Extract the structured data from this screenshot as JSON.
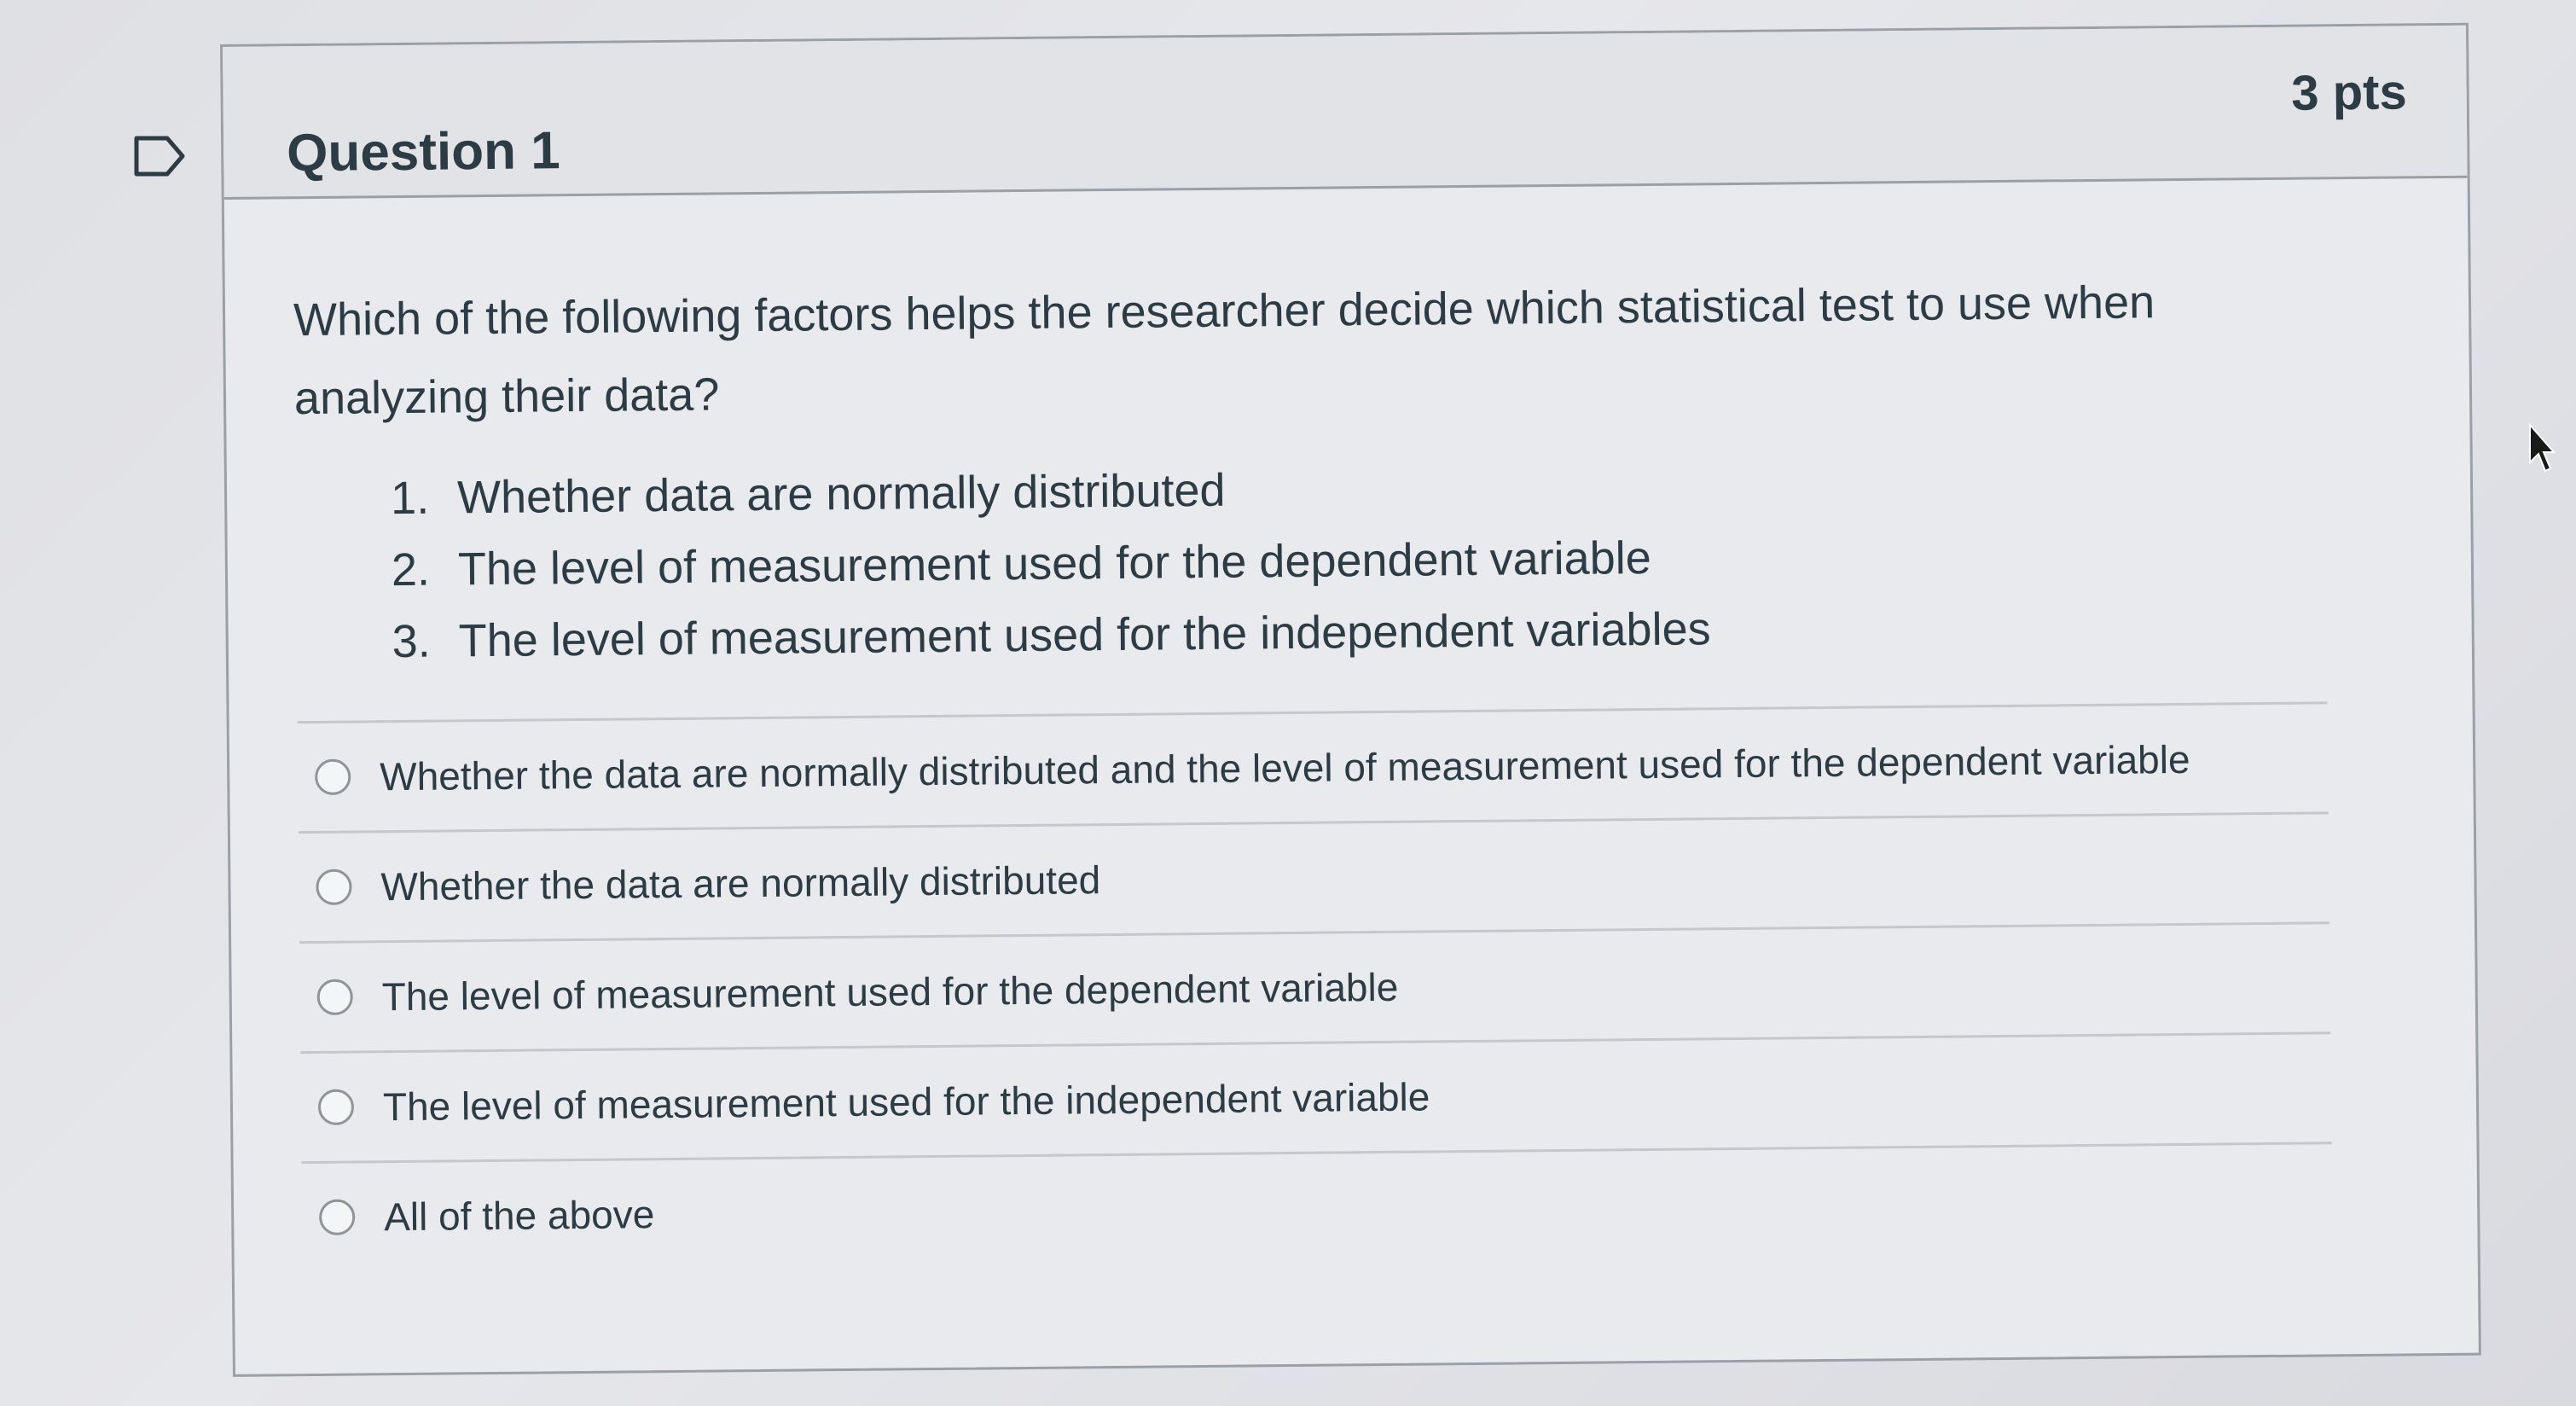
{
  "question": {
    "title": "Question 1",
    "points": "3 pts",
    "prompt": "Which of the following factors helps the researcher decide which statistical test to use when analyzing their data?",
    "factors": [
      {
        "num": "1.",
        "text": "Whether data are normally distributed"
      },
      {
        "num": "2.",
        "text": "The level of measurement used for the dependent variable"
      },
      {
        "num": "3.",
        "text": "The level of measurement used for the independent variables"
      }
    ],
    "answers": [
      {
        "label": "Whether the data are normally distributed and the level of measurement used for the dependent variable",
        "selected": false
      },
      {
        "label": "Whether the data are normally distributed",
        "selected": false
      },
      {
        "label": "The level of measurement used for the dependent variable",
        "selected": false
      },
      {
        "label": "The level of measurement used for the independent variable",
        "selected": false
      },
      {
        "label": "All of the above",
        "selected": false
      }
    ]
  },
  "icons": {
    "flag": "flag-outline-icon",
    "cursor": "mouse-pointer-icon"
  },
  "colors": {
    "text": "#2d3b45",
    "border": "#9aa0a6",
    "background": "#e9eaee"
  }
}
